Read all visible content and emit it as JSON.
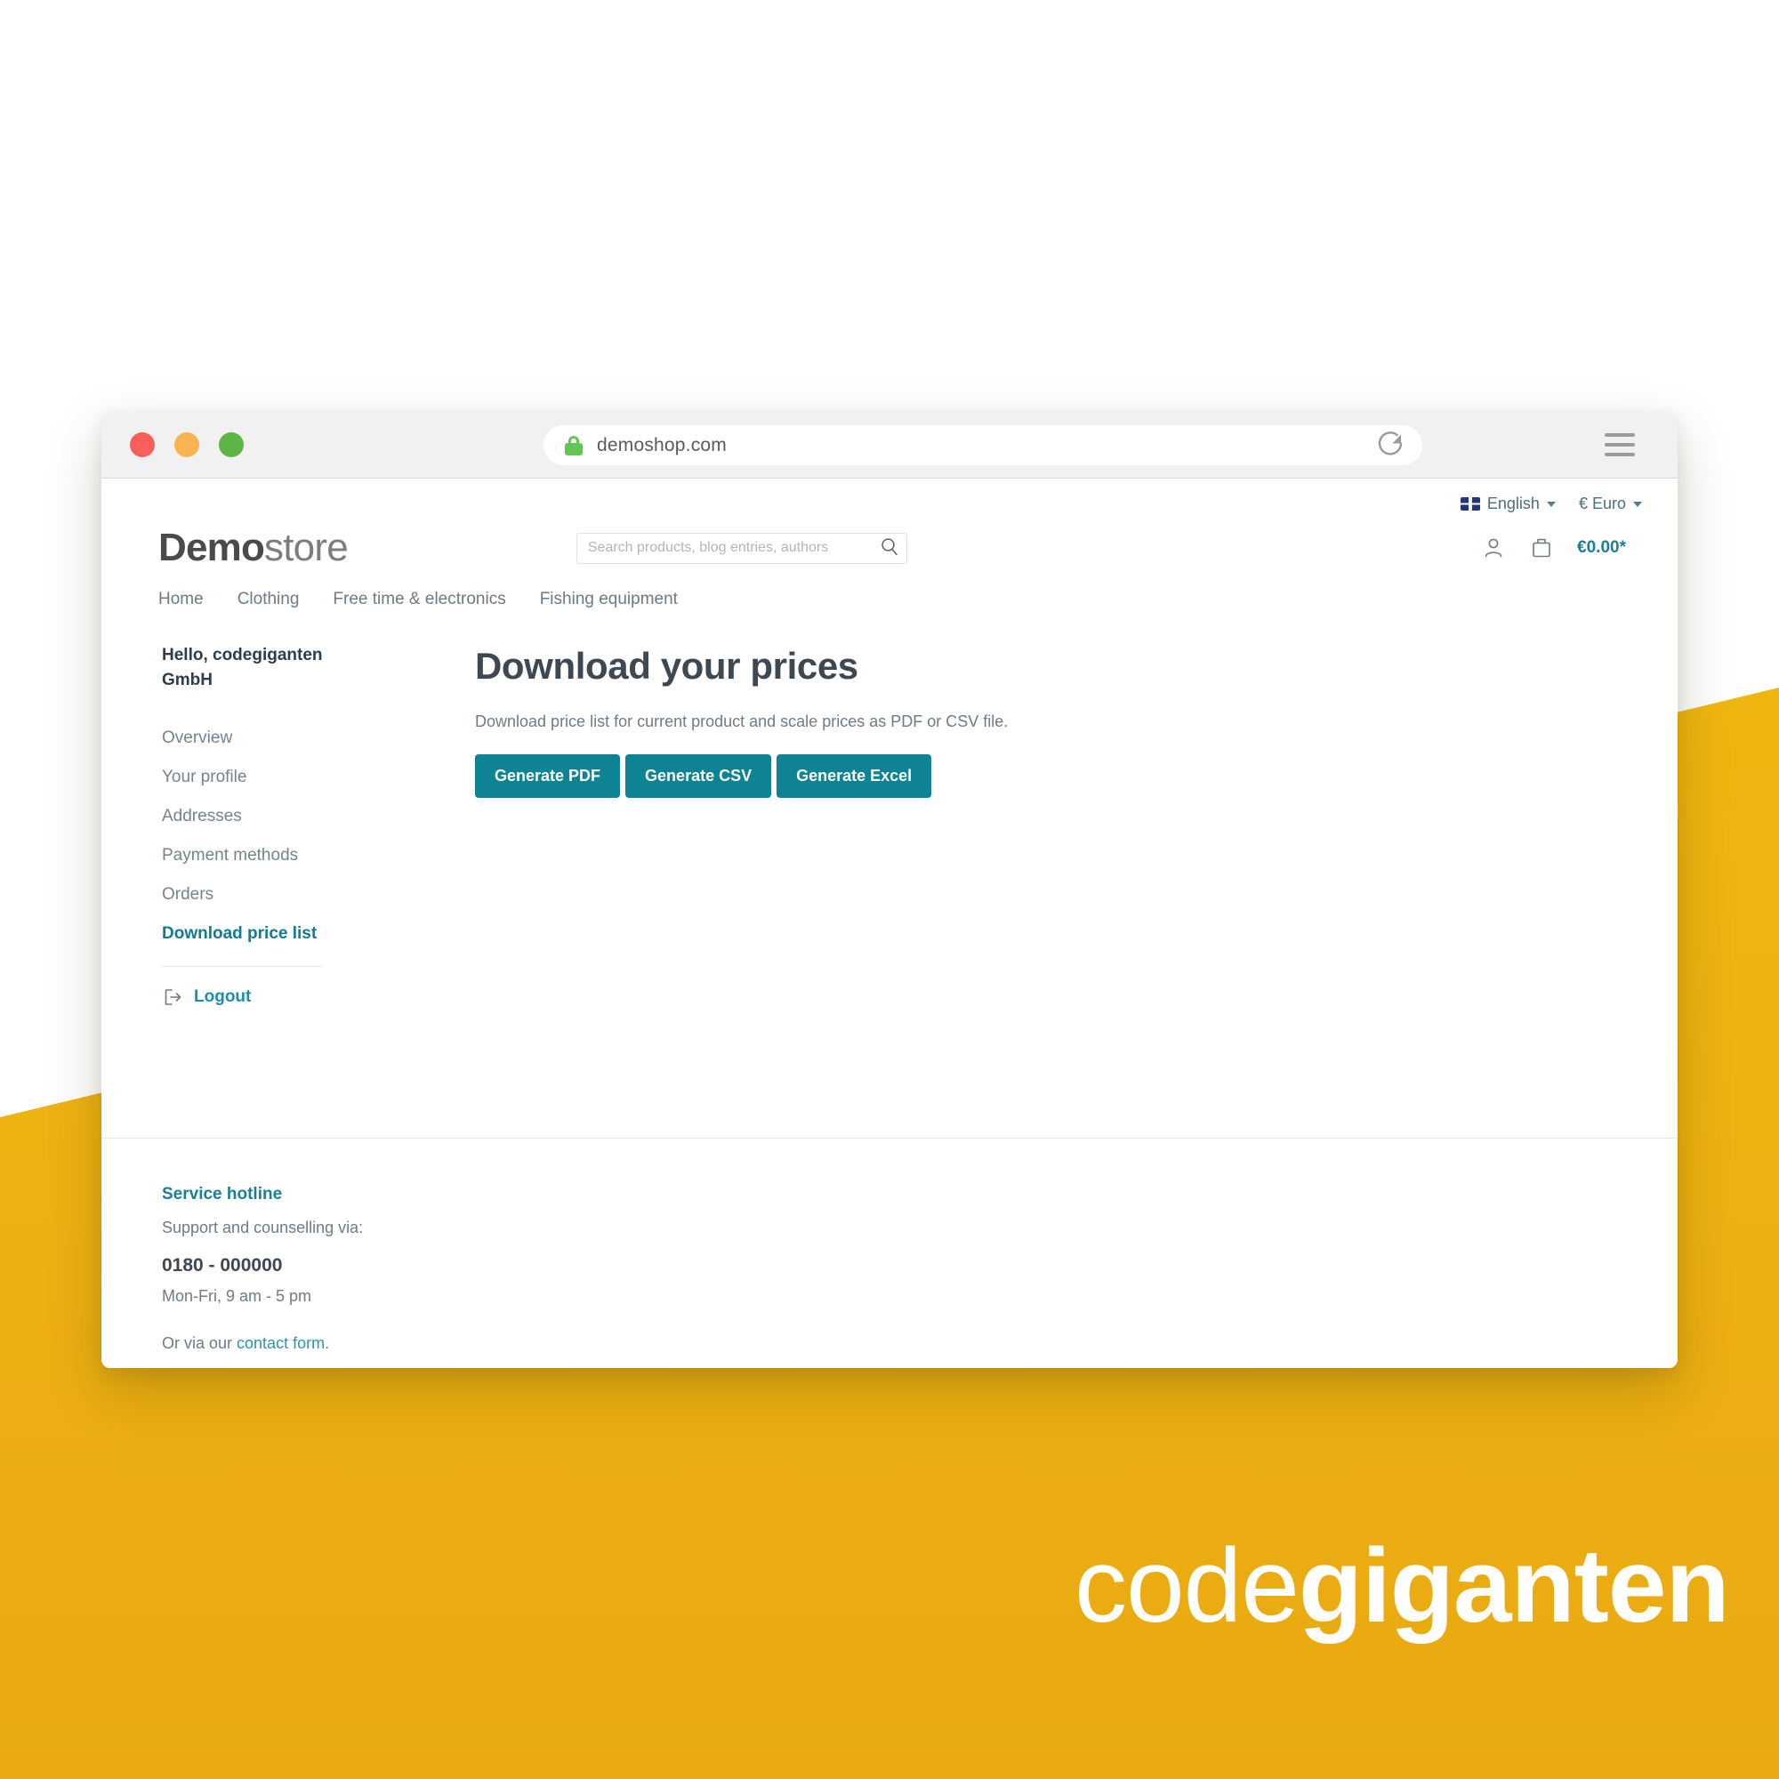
{
  "browser": {
    "url": "demoshop.com",
    "lock_icon": "lock-icon",
    "reload_icon": "reload-icon",
    "menu_icon": "hamburger-menu-icon",
    "traffic_lights": [
      "close-red",
      "minimize-amber",
      "maximize-green"
    ]
  },
  "topbar": {
    "language": "English",
    "language_flag": "uk-flag-icon",
    "currency": "€ Euro"
  },
  "brand": {
    "bold": "Demo",
    "light": "store"
  },
  "search": {
    "placeholder": "Search products, blog entries, authors",
    "value": "",
    "icon": "search-icon"
  },
  "header_right": {
    "account_icon": "user-account-icon",
    "cart_icon": "shopping-bag-icon",
    "cart_total": "€0.00*"
  },
  "mainnav": {
    "items": [
      {
        "label": "Home"
      },
      {
        "label": "Clothing"
      },
      {
        "label": "Free time & electronics"
      },
      {
        "label": "Fishing equipment"
      }
    ]
  },
  "sidebar": {
    "greeting": "Hello, codegiganten GmbH",
    "items": [
      {
        "label": "Overview",
        "active": false
      },
      {
        "label": "Your profile",
        "active": false
      },
      {
        "label": "Addresses",
        "active": false
      },
      {
        "label": "Payment methods",
        "active": false
      },
      {
        "label": "Orders",
        "active": false
      },
      {
        "label": "Download price list",
        "active": true
      }
    ],
    "logout": {
      "label": "Logout",
      "icon": "logout-icon"
    }
  },
  "main": {
    "title": "Download your prices",
    "subtitle": "Download price list for current product and scale prices as PDF or CSV file.",
    "buttons": [
      {
        "label": "Generate PDF"
      },
      {
        "label": "Generate CSV"
      },
      {
        "label": "Generate Excel"
      }
    ]
  },
  "footer": {
    "title": "Service hotline",
    "support_line": "Support and counselling via:",
    "phone": "0180 - 000000",
    "hours": "Mon-Fri, 9 am - 5 pm",
    "contact_prefix": "Or via our ",
    "contact_link": "contact form",
    "contact_suffix": "."
  },
  "watermark": {
    "word_light": "code",
    "word_bold": "giganten",
    "mark_icon": "codegiganten-diamond-logo"
  },
  "colors": {
    "accent_teal": "#0d8394",
    "link_teal": "#1b8fb0",
    "brand_yellow": "#eeb111",
    "text_dark": "#3d4852",
    "text_muted": "#6f7b85"
  }
}
